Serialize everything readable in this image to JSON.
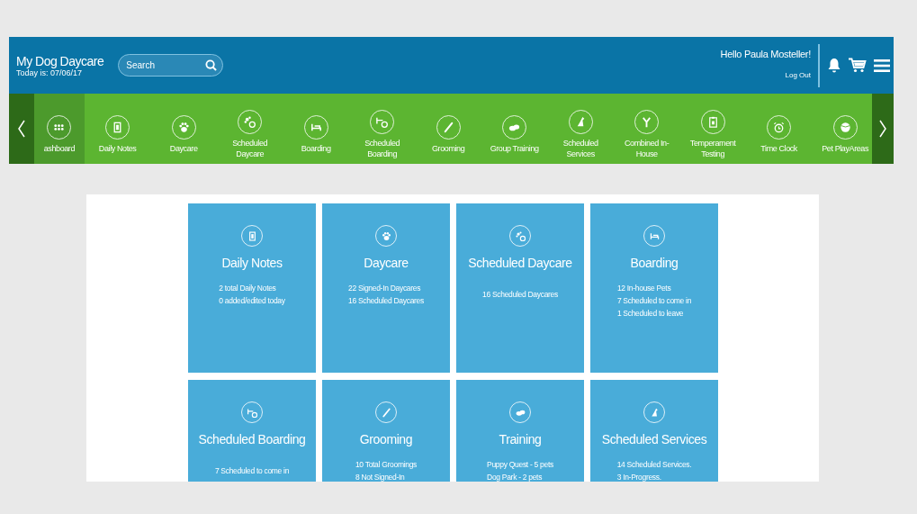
{
  "header": {
    "title": "My Dog Daycare",
    "date": "Today is: 07/06/17",
    "search": {
      "placeholder": "Search"
    },
    "greeting": "Hello Paula Mosteller!",
    "logout": "Log Out"
  },
  "nav": [
    {
      "label": "ashboard",
      "selected": true
    },
    {
      "label": "Daily Notes",
      "selected": false
    },
    {
      "label": "Daycare",
      "selected": false
    },
    {
      "label": "Scheduled Daycare",
      "selected": false
    },
    {
      "label": "Boarding",
      "selected": false
    },
    {
      "label": "Scheduled Boarding",
      "selected": false
    },
    {
      "label": "Grooming",
      "selected": false
    },
    {
      "label": "Group Training",
      "selected": false
    },
    {
      "label": "Scheduled Services",
      "selected": false
    },
    {
      "label": "Combined In-House",
      "selected": false
    },
    {
      "label": "Temperament Testing",
      "selected": false
    },
    {
      "label": "Time Clock",
      "selected": false
    },
    {
      "label": "Pet PlayAreas",
      "selected": false
    }
  ],
  "cards": [
    {
      "title": "Daily Notes",
      "lines": [
        "2 total Daily Notes",
        "0 added/edited today"
      ]
    },
    {
      "title": "Daycare",
      "lines": [
        "22 Signed-In Daycares",
        "16 Scheduled Daycares"
      ]
    },
    {
      "title": "Scheduled Daycare",
      "lines": [
        "16 Scheduled Daycares"
      ]
    },
    {
      "title": "Boarding",
      "lines": [
        "12 In-house Pets",
        "7 Scheduled to come in",
        "1 Scheduled to leave"
      ]
    },
    {
      "title": "Scheduled Boarding",
      "lines": [
        "7 Scheduled to come in"
      ]
    },
    {
      "title": "Grooming",
      "lines": [
        "10 Total Groomings",
        "8 Not Signed-In"
      ]
    },
    {
      "title": "Training",
      "lines": [
        "Puppy Quest - 5 pets",
        "Dog Park - 2 pets"
      ]
    },
    {
      "title": "Scheduled Services",
      "lines": [
        "14 Scheduled Services.",
        "3 In-Progress."
      ]
    }
  ]
}
